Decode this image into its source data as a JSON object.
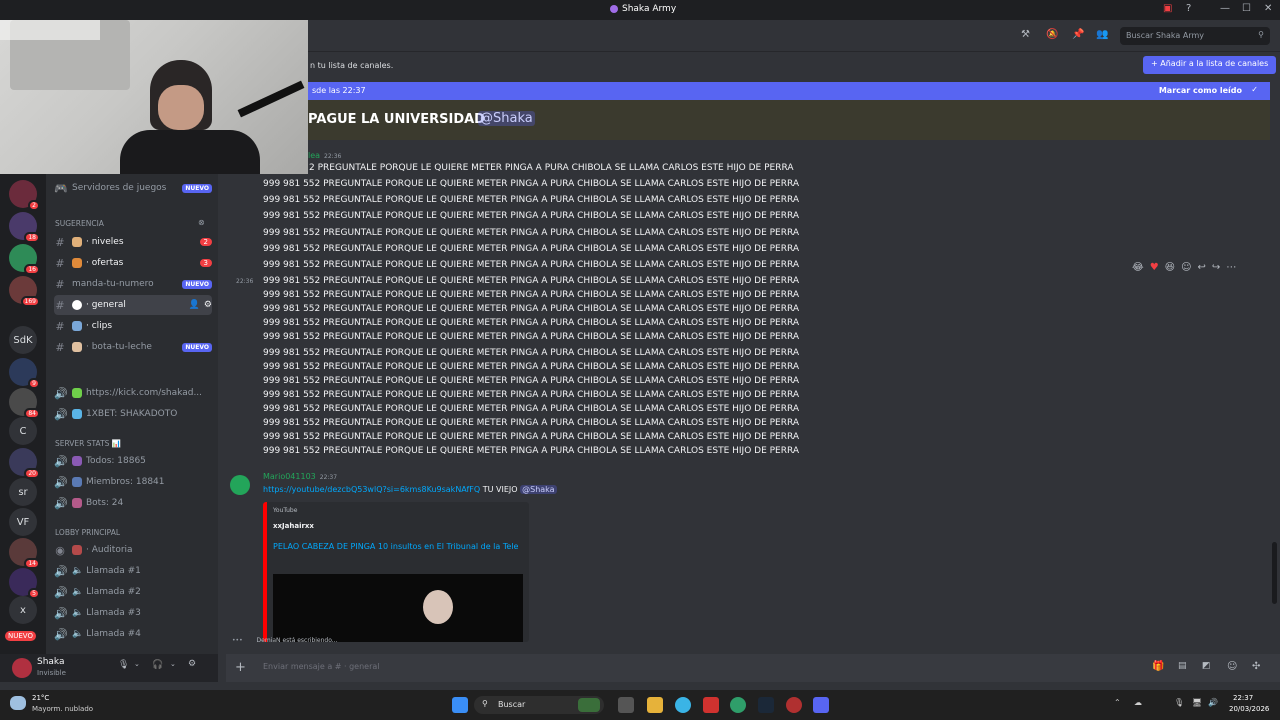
{
  "window": {
    "title": "Shaka Army"
  },
  "header": {
    "search_placeholder": "Buscar Shaka Army",
    "notice_text": "n tu lista de canales.",
    "add_button": "+ Añadir a la lista de canales",
    "new_messages_since": "sde las 22:37",
    "mark_read": "Marcar como leído"
  },
  "sidebar": {
    "game_servers": "Servidores de juegos",
    "game_servers_badge": "NUEVO",
    "suggestion_label": "Sugerencia",
    "channels": [
      {
        "name": "· niveles",
        "count": "2",
        "unread": true
      },
      {
        "name": "· ofertas",
        "count": "3",
        "unread": true
      },
      {
        "name": "manda-tu-numero",
        "new": "NUEVO"
      },
      {
        "name": "· general",
        "active": true
      },
      {
        "name": "· clips",
        "unread": true
      },
      {
        "name": "· bota-tu-leche",
        "new": "NUEVO"
      }
    ],
    "voice_top": [
      {
        "name": "https://kick.com/shakad..."
      },
      {
        "name": "1XBET: SHAKADOTO"
      }
    ],
    "stats_category": "SERVER STATS 📊",
    "stats": [
      {
        "name": "Todos: 18865"
      },
      {
        "name": "Miembros: 18841"
      },
      {
        "name": "Bots: 24"
      }
    ],
    "lobby_category": "LOBBY PRINCIPAL",
    "lobby": [
      {
        "name": "· Auditoria"
      },
      {
        "name": "Llamada #1"
      },
      {
        "name": "Llamada #2"
      },
      {
        "name": "Llamada #3"
      },
      {
        "name": "Llamada #4"
      }
    ]
  },
  "servers": {
    "labels": [
      "SdK",
      "C",
      "sr",
      "VF",
      "x"
    ],
    "badges": [
      "2",
      "18",
      "16",
      "169",
      "9",
      "84",
      "20",
      "14",
      "5"
    ],
    "nuevo": "NUEVO"
  },
  "user": {
    "name": "Shaka",
    "status": "Invisible"
  },
  "chat": {
    "big_message": "PAGUE LA UNIVERSIDAD",
    "big_mention": "@Shaka",
    "first_author": "lea",
    "first_time": "22:36",
    "side_time": "22:36",
    "repeated_first": "2 PREGUNTALE PORQUE LE QUIERE METER PINGA A PURA CHIBOLA SE LLAMA CARLOS ESTE HIJO DE PERRA",
    "repeated": "999 981 552 PREGUNTALE PORQUE LE QUIERE METER PINGA A PURA CHIBOLA SE LLAMA CARLOS ESTE HIJO DE PERRA",
    "second_author": "Mario041103",
    "second_time": "22:37",
    "link": "https://youtube/dezcbQ53wlQ?si=6kms8Ku9sakNAfFQ",
    "link_suffix": "TU VIEJO",
    "link_mention": "@Shaka",
    "embed_provider": "YouTube",
    "embed_author": "xxJahairxx",
    "embed_title": "PELAO CABEZA DE PINGA 10 insultos en El Tribunal de la Tele",
    "typing": "DemiaN está escribiendo...",
    "composer_placeholder": "Enviar mensaje a #",
    "composer_channel": "· general"
  },
  "taskbar": {
    "weather_temp": "21°C",
    "weather_desc": "Mayorm. nublado",
    "search": "Buscar",
    "time": "22:37",
    "date": "20/03/2026"
  },
  "colors": {
    "accent": "#5865f2",
    "danger": "#f23f43",
    "online": "#23a55a"
  }
}
